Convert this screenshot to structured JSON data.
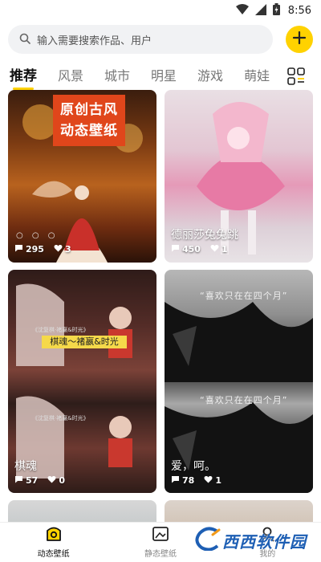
{
  "status_bar": {
    "time": "8:56"
  },
  "search": {
    "placeholder": "输入需要搜索作品、用户"
  },
  "tabs": [
    {
      "label": "推荐",
      "active": true
    },
    {
      "label": "风景"
    },
    {
      "label": "城市"
    },
    {
      "label": "明星"
    },
    {
      "label": "游戏"
    },
    {
      "label": "萌娃"
    }
  ],
  "cards": [
    {
      "title": "",
      "banner_line1": "原创古风",
      "banner_line2": "动态壁纸",
      "dots": "○ ○ ○",
      "comments": "295",
      "likes": "3"
    },
    {
      "title": "德丽莎兔兔跳",
      "comments": "450",
      "likes": "1"
    },
    {
      "title": "棋魂",
      "subtitle": "棋魂～褚嬴&时光",
      "comments": "57",
      "likes": "0"
    },
    {
      "title": "爱，呵。",
      "quote": "“喜欢只在在四个月”",
      "comments": "78",
      "likes": "1"
    }
  ],
  "bottom_nav": [
    {
      "label": "动态壁纸",
      "active": true
    },
    {
      "label": "静态壁纸"
    },
    {
      "label": "我的"
    }
  ],
  "watermark": {
    "text": "西西软件园"
  },
  "colors": {
    "accent": "#ffd200",
    "banner": "#e0461b"
  }
}
